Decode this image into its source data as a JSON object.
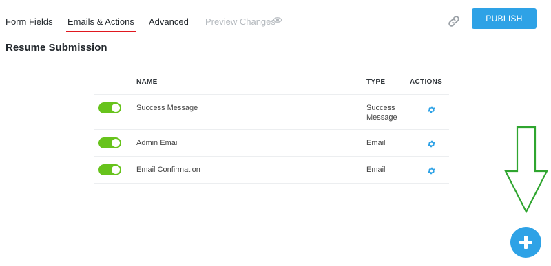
{
  "tabs": [
    {
      "label": "Form Fields",
      "active": false
    },
    {
      "label": "Emails & Actions",
      "active": true
    },
    {
      "label": "Advanced",
      "active": false
    },
    {
      "label": "Preview Changes",
      "active": false,
      "icon": "eye-icon"
    }
  ],
  "header": {
    "link_icon": "link-icon",
    "publish_label": "PUBLISH"
  },
  "page": {
    "title": "Resume Submission"
  },
  "table": {
    "columns": [
      "NAME",
      "TYPE",
      "ACTIONS"
    ],
    "rows": [
      {
        "enabled": true,
        "name": "Success Message",
        "type": "Success Message",
        "action_icon": "gear-icon"
      },
      {
        "enabled": true,
        "name": "Admin Email",
        "type": "Email",
        "action_icon": "gear-icon"
      },
      {
        "enabled": true,
        "name": "Email Confirmation",
        "type": "Email",
        "action_icon": "gear-icon"
      }
    ]
  },
  "annotation": {
    "arrow_icon": "down-arrow-icon",
    "arrow_color": "#2fa52f"
  },
  "fab": {
    "icon": "plus-icon"
  },
  "colors": {
    "accent": "#2ea2e6",
    "active_tab_underline": "#e0181f",
    "toggle_on": "#67c31c"
  }
}
